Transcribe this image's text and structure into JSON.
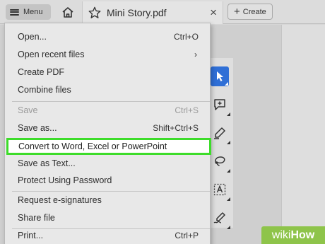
{
  "tabbar": {
    "menu_label": "Menu",
    "document_title": "Mini Story.pdf",
    "close_symbol": "×",
    "create_label": "Create"
  },
  "menu": {
    "items": [
      {
        "label": "Open...",
        "shortcut": "Ctrl+O",
        "disabled": false
      },
      {
        "label": "Open recent files",
        "shortcut": "",
        "submenu": true,
        "disabled": false
      },
      {
        "label": "Create PDF",
        "shortcut": "",
        "disabled": false
      },
      {
        "label": "Combine files",
        "shortcut": "",
        "disabled": false
      },
      {
        "label": "Save",
        "shortcut": "Ctrl+S",
        "disabled": true
      },
      {
        "label": "Save as...",
        "shortcut": "Shift+Ctrl+S",
        "disabled": false
      },
      {
        "label": "Convert to Word, Excel or PowerPoint",
        "shortcut": "",
        "highlighted": true,
        "disabled": false
      },
      {
        "label": "Save as Text...",
        "shortcut": "",
        "disabled": false
      },
      {
        "label": "Protect Using Password",
        "shortcut": "",
        "disabled": false
      },
      {
        "label": "Request e-signatures",
        "shortcut": "",
        "disabled": false
      },
      {
        "label": "Share file",
        "shortcut": "",
        "disabled": false
      },
      {
        "label": "Print...",
        "shortcut": "Ctrl+P",
        "disabled": false
      }
    ],
    "submenu_symbol": "›"
  },
  "toolbar": {
    "tools": [
      "select-cursor-icon",
      "add-comment-icon",
      "draw-pen-icon",
      "lasso-icon",
      "text-box-icon",
      "signature-icon"
    ],
    "active_tool": "select-cursor-icon"
  },
  "colors": {
    "highlight_border": "#3ddc2a",
    "active_tool": "#2f6fd6",
    "watermark": "#8ec44a"
  },
  "watermark": {
    "prefix": "wiki",
    "suffix": "How"
  }
}
